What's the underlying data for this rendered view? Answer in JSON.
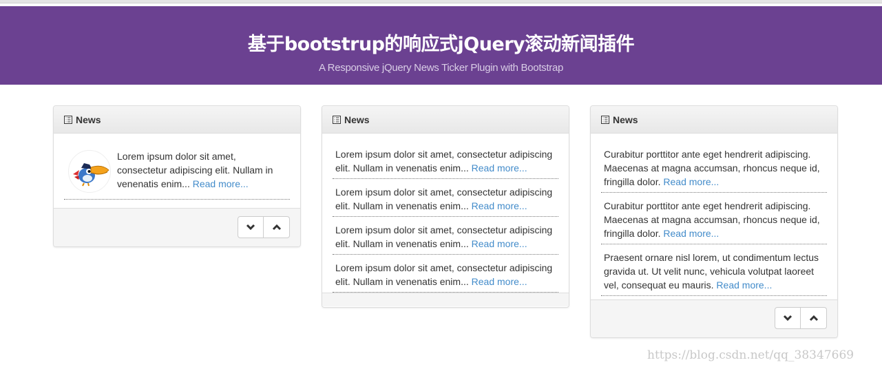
{
  "header": {
    "title": "基于bootstrup的响应式jQuery滚动新闻插件",
    "subtitle": "A Responsive jQuery News Ticker Plugin with Bootstrap"
  },
  "panels": [
    {
      "heading": "News",
      "items": [
        {
          "text": "Lorem ipsum dolor sit amet, consectetur adipiscing elit. Nullam in venenatis enim...",
          "link": "Read more..."
        }
      ]
    },
    {
      "heading": "News",
      "items": [
        {
          "text": "Lorem ipsum dolor sit amet, consectetur adipiscing elit. Nullam in venenatis enim...",
          "link": "Read more..."
        },
        {
          "text": "Lorem ipsum dolor sit amet, consectetur adipiscing elit. Nullam in venenatis enim...",
          "link": "Read more..."
        },
        {
          "text": "Lorem ipsum dolor sit amet, consectetur adipiscing elit. Nullam in venenatis enim...",
          "link": "Read more..."
        },
        {
          "text": "Lorem ipsum dolor sit amet, consectetur adipiscing elit. Nullam in venenatis enim...",
          "link": "Read more..."
        }
      ]
    },
    {
      "heading": "News",
      "items": [
        {
          "text": "Curabitur porttitor ante eget hendrerit adipiscing. Maecenas at magna accumsan, rhoncus neque id, fringilla dolor.",
          "link": "Read more..."
        },
        {
          "text": "Curabitur porttitor ante eget hendrerit adipiscing. Maecenas at magna accumsan, rhoncus neque id, fringilla dolor.",
          "link": "Read more..."
        },
        {
          "text": "Praesent ornare nisl lorem, ut condimentum lectus gravida ut. Ut velit nunc, vehicula volutpat laoreet vel, consequat eu mauris.",
          "link": "Read more..."
        }
      ]
    }
  ],
  "icons": {
    "heading": "list-icon",
    "down": "chevron-down-icon",
    "up": "chevron-up-icon",
    "avatar": "bird-avatar"
  },
  "colors": {
    "banner": "#6b4191",
    "link": "#428bca"
  },
  "watermark": "https://blog.csdn.net/qq_38347669"
}
